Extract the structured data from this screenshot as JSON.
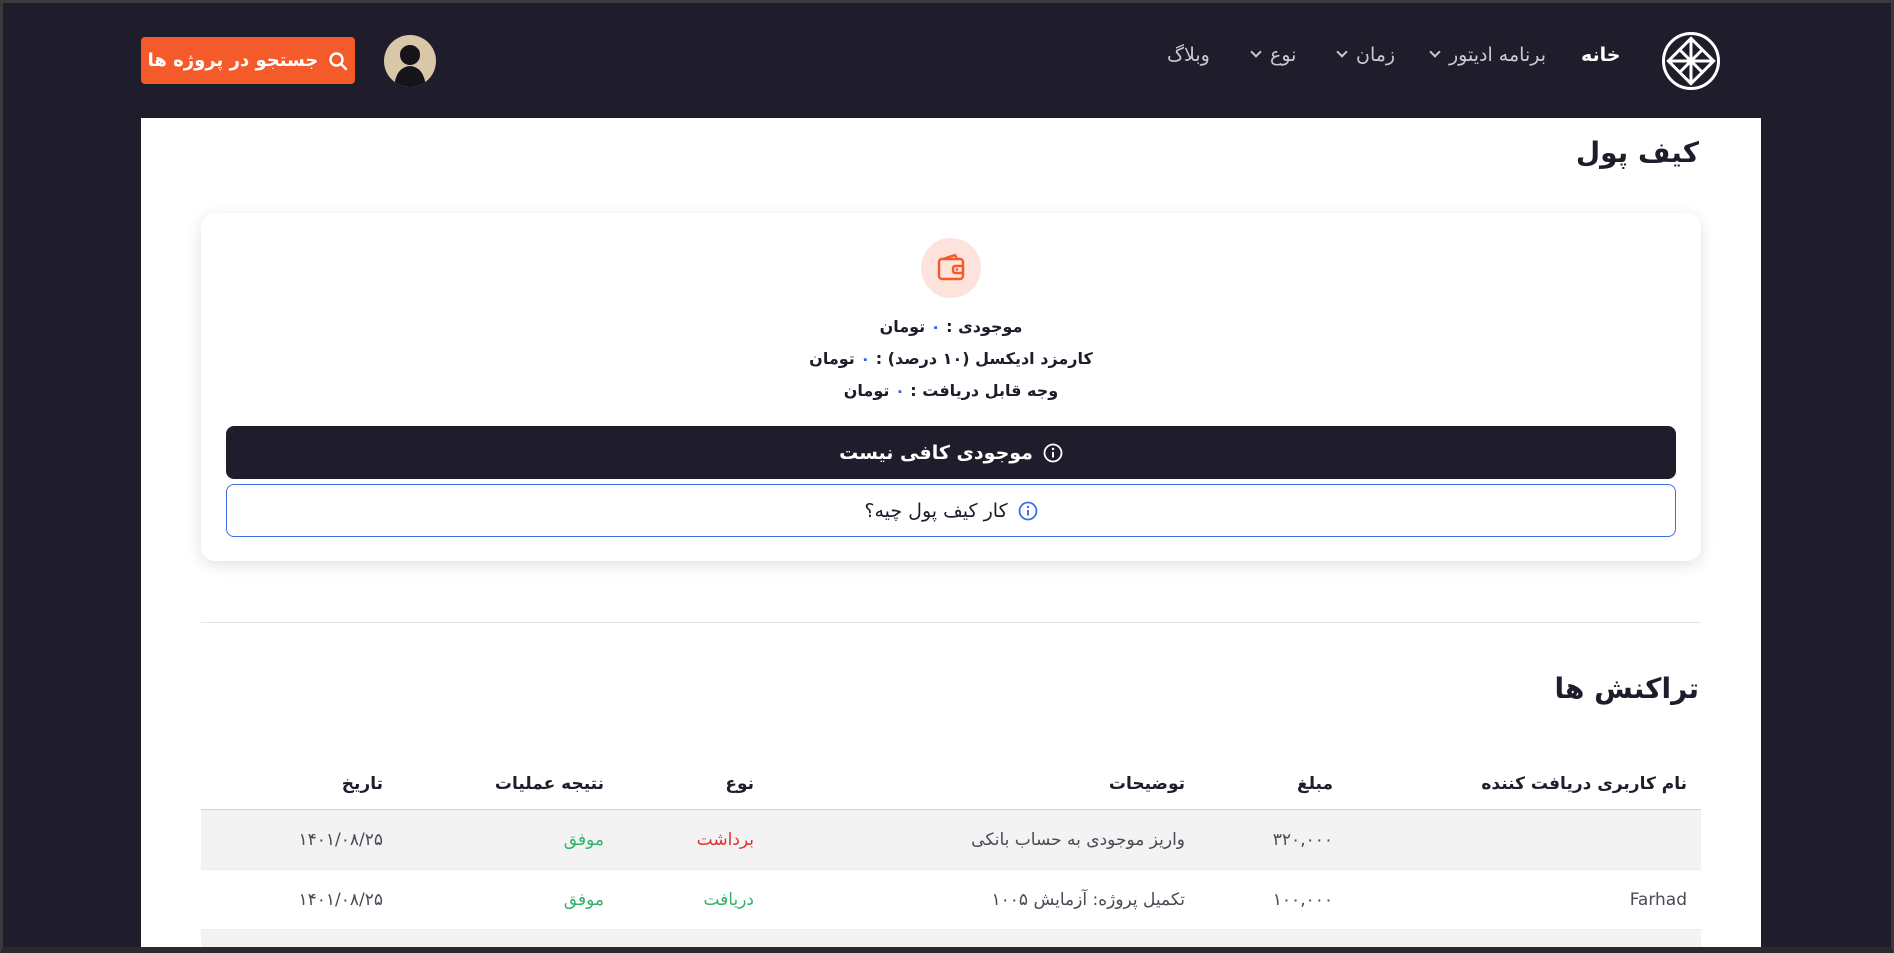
{
  "nav": {
    "home": "خانه",
    "editor_program": "برنامه ادیتور",
    "time": "زمان",
    "type": "نوع",
    "blog": "وبلاگ",
    "search_button": "جستجو در پروژه ها"
  },
  "wallet": {
    "title": "کیف پول",
    "balance_label": "موجودی :",
    "balance_value": "۰",
    "commission_label": "کارمزد ادیکسل (۱۰ درصد) :",
    "commission_value": "۰",
    "withdrawable_label": "وجه قابل دریافت :",
    "withdrawable_value": "۰",
    "currency": "تومان",
    "insufficient_button": "موجودی کافی نیست",
    "how_button": "کار کیف پول چیه؟"
  },
  "transactions": {
    "title": "تراکنش ها",
    "headers": {
      "receiver": "نام کاربری دریافت کننده",
      "amount": "مبلغ",
      "description": "توضیحات",
      "type": "نوع",
      "result": "نتیجه عملیات",
      "date": "تاریخ"
    },
    "rows": [
      {
        "receiver": "",
        "amount": "۳۲۰,۰۰۰",
        "description": "واریز موجودی به حساب بانکی",
        "type": "برداشت",
        "result": "موفق",
        "date": "۱۴۰۱/۰۸/۲۵"
      },
      {
        "receiver": "Farhad",
        "amount": "۱۰۰,۰۰۰",
        "description": "تکمیل پروژه: آزمایش ۱۰۰۵",
        "type": "دریافت",
        "result": "موفق",
        "date": "۱۴۰۱/۰۸/۲۵"
      }
    ]
  },
  "colors": {
    "nav_bg": "#1f1d2b",
    "accent": "#f45a2a",
    "link_blue": "#3b6ee8",
    "success": "#2fb36b",
    "danger": "#e03131"
  }
}
